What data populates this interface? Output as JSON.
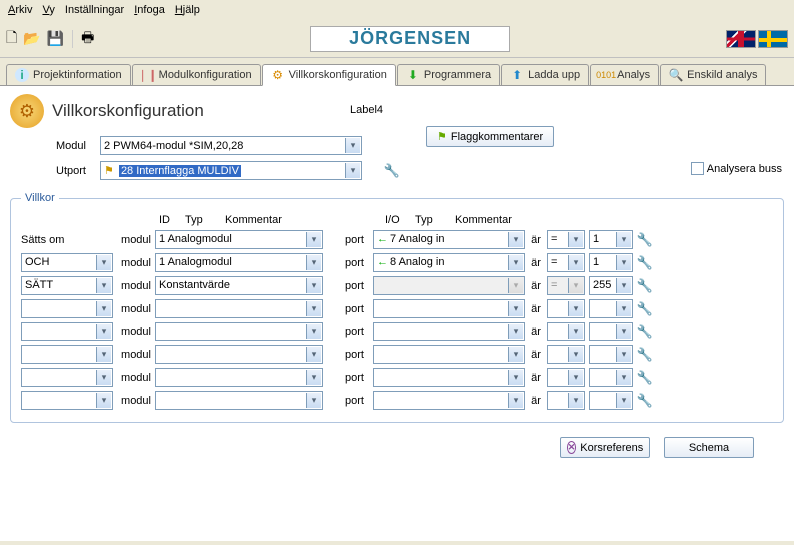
{
  "menu": {
    "arkiv": "Arkiv",
    "vy": "Vy",
    "installningar": "Inställningar",
    "infoga": "Infoga",
    "hjalp": "Hjälp"
  },
  "logo": "JÖRGENSEN",
  "tabs": {
    "proj": "Projektinformation",
    "modkonf": "Modulkonfiguration",
    "villkor": "Villkorskonfiguration",
    "prog": "Programmera",
    "ladda": "Ladda upp",
    "analys": "Analys",
    "enskild": "Enskild analys"
  },
  "page_title": "Villkorskonfiguration",
  "label4": "Label4",
  "modul_label": "Modul",
  "modul_value": "2 PWM64-modul  *SIM,20,28",
  "utport_label": "Utport",
  "utport_value": "28 Internflagga MULDIV",
  "flagg_btn": "Flaggkommentarer",
  "flagg_icon": "🏳",
  "analys_buss": "Analysera buss",
  "villkor_legend": "Villkor",
  "head": {
    "id": "ID",
    "typ": "Typ",
    "kommentar": "Kommentar",
    "io": "I/O",
    "ar": "är"
  },
  "satts_om": "Sätts om",
  "modul_lbl": "modul",
  "port_lbl": "port",
  "rows": [
    {
      "left": "",
      "modul": "1 Analogmodul",
      "port": "7  Analog in",
      "op": "=",
      "val": "1"
    },
    {
      "left": "OCH",
      "modul": "1 Analogmodul",
      "port": "8  Analog in",
      "op": "=",
      "val": "1"
    },
    {
      "left": "SÄTT",
      "modul": "Konstantvärde",
      "port": "",
      "op": "=",
      "val": "255",
      "disabled": true
    },
    {
      "left": "",
      "modul": "",
      "port": "",
      "op": "",
      "val": ""
    },
    {
      "left": "",
      "modul": "",
      "port": "",
      "op": "",
      "val": ""
    },
    {
      "left": "",
      "modul": "",
      "port": "",
      "op": "",
      "val": ""
    },
    {
      "left": "",
      "modul": "",
      "port": "",
      "op": "",
      "val": ""
    },
    {
      "left": "",
      "modul": "",
      "port": "",
      "op": "",
      "val": ""
    }
  ],
  "korsref": "Korsreferens",
  "schema": "Schema"
}
